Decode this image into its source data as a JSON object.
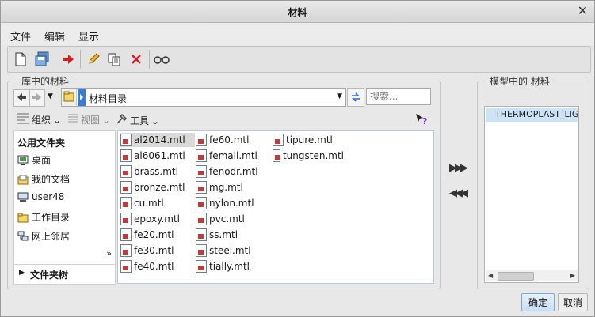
{
  "window": {
    "title": "材料"
  },
  "menu": [
    "文件",
    "编辑",
    "显示"
  ],
  "toolbar": {
    "icons": [
      "new-icon",
      "save-icon",
      "arrow-right-red-icon",
      "pencil-icon",
      "copy-icon",
      "delete-x-icon",
      "glasses-icon"
    ]
  },
  "library": {
    "legend": "库中的材料",
    "address": "材料目录",
    "search_placeholder": "搜索...",
    "tools": {
      "organize": "组织",
      "view": "视图",
      "tools": "工具"
    },
    "sidebar": {
      "heading": "公用文件夹",
      "items": [
        "桌面",
        "我的文档",
        "user48",
        "工作目录",
        "网上邻居"
      ],
      "folder_tree": "文件夹树",
      "expand_glyph": "»"
    },
    "files_col1": [
      "al2014.mtl",
      "al6061.mtl",
      "brass.mtl",
      "bronze.mtl",
      "cu.mtl",
      "epoxy.mtl",
      "fe20.mtl",
      "fe30.mtl",
      "fe40.mtl"
    ],
    "files_col2": [
      "fe60.mtl",
      "femall.mtl",
      "fenodr.mtl",
      "mg.mtl",
      "nylon.mtl",
      "pvc.mtl",
      "ss.mtl",
      "steel.mtl",
      "tially.mtl"
    ],
    "files_col3": [
      "tipure.mtl",
      "tungsten.mtl"
    ],
    "selected_file": "al2014.mtl"
  },
  "transfer": {
    "add": "▶▶▶",
    "remove": "◀◀◀"
  },
  "model": {
    "legend": "模型中的 材料",
    "items": [
      "THERMOPLAST_LIG"
    ]
  },
  "buttons": {
    "ok": "确定",
    "cancel": "取消"
  }
}
